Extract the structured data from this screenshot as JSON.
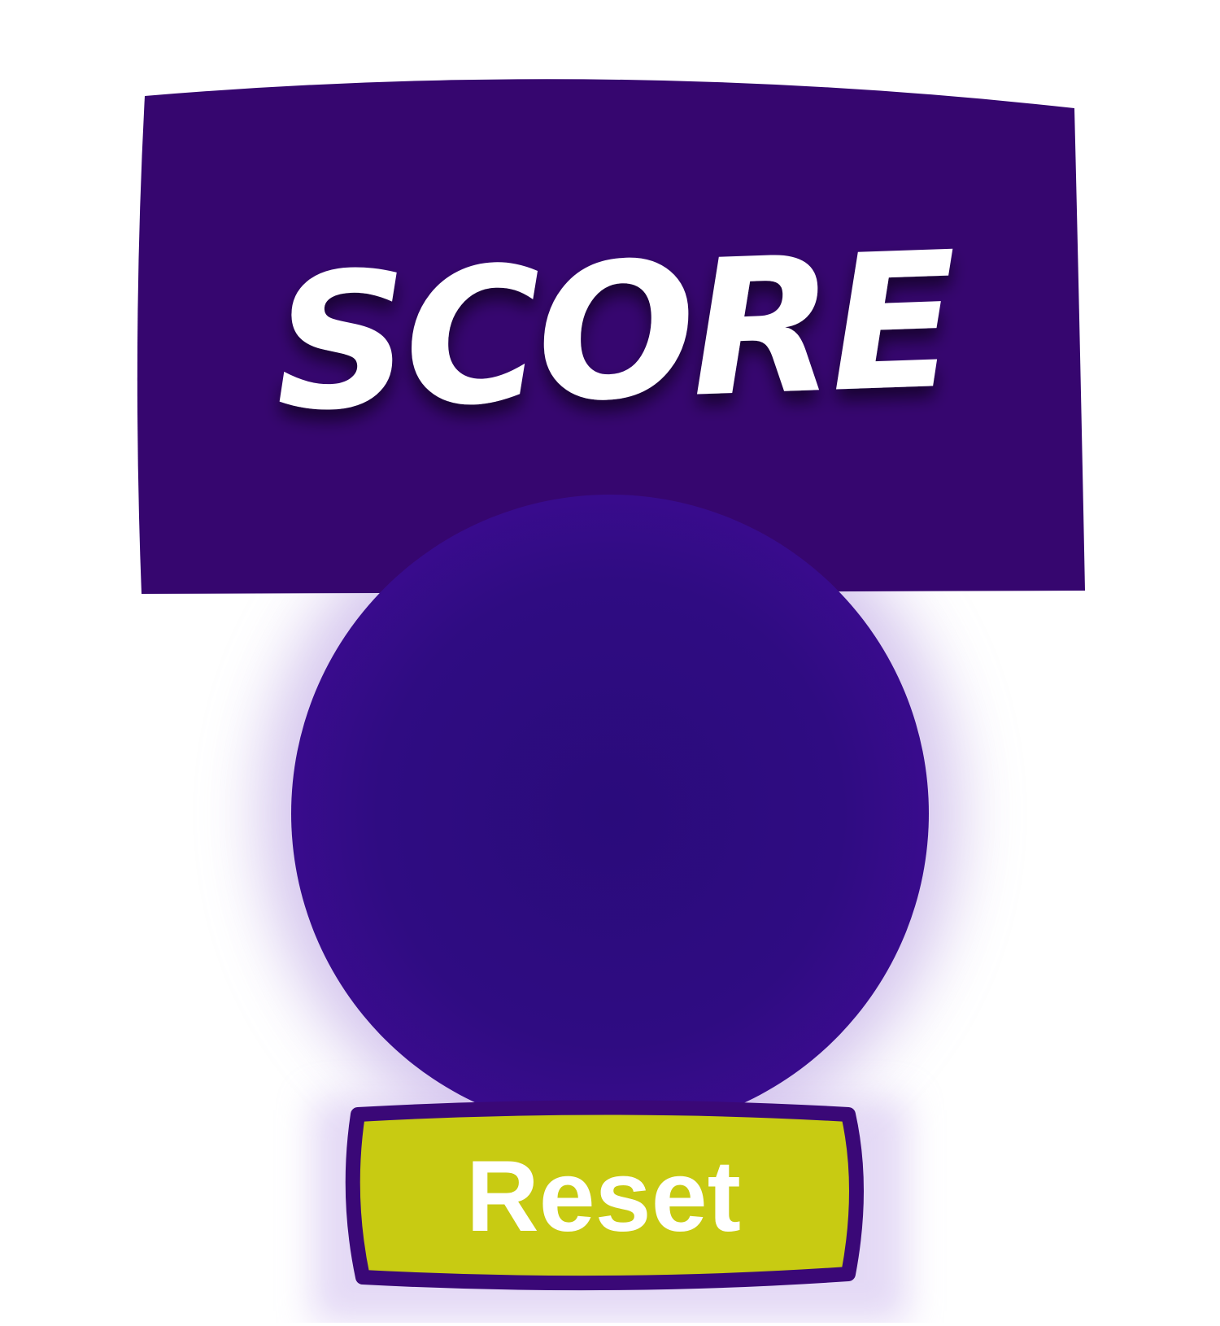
{
  "header": {
    "title": "SCORE",
    "background_color": "#36066f",
    "text_color": "#ffffff"
  },
  "score_display": {
    "value": "",
    "fill_color": "#2f0c81",
    "edge_color": "#3a0b8e",
    "glow_color": "#b49ae0"
  },
  "reset_button": {
    "label": "Reset",
    "fill_color": "#c8cb12",
    "border_color": "#3a0877",
    "text_color": "#ffffff"
  }
}
